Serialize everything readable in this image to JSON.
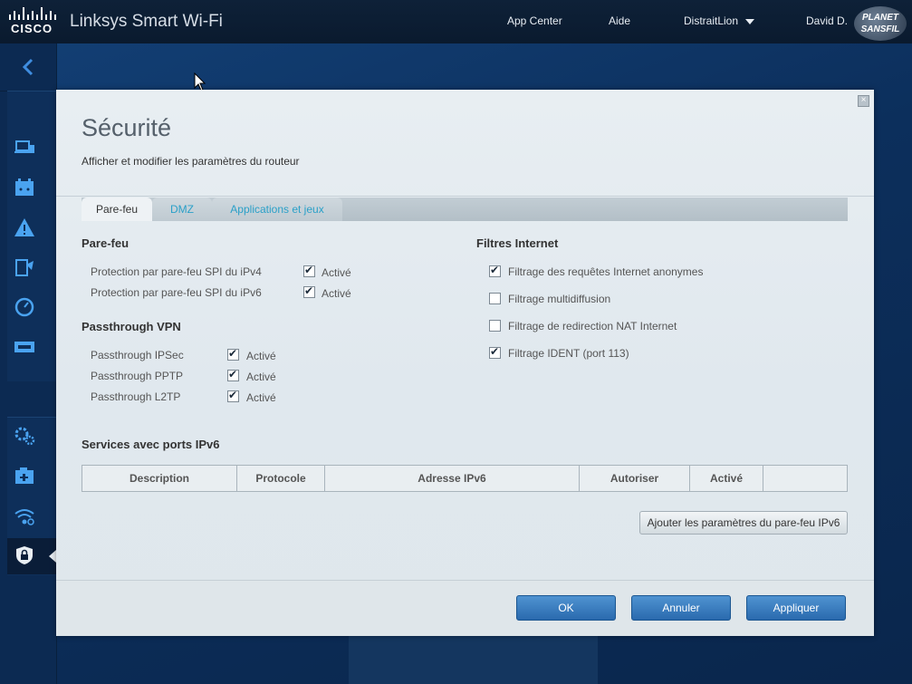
{
  "header": {
    "cisco": "CISCO",
    "brand": "Linksys Smart Wi-Fi",
    "nav": {
      "app_center": "App Center",
      "help": "Aide",
      "network": "DistraitLion",
      "user": "David D."
    },
    "watermark": "PLANET SANSFIL"
  },
  "sidebar": {
    "icons": [
      "back-arrow-icon",
      "devices-icon",
      "calendar-icon",
      "warning-icon",
      "update-icon",
      "speedometer-icon",
      "usb-icon",
      "settings-icon",
      "camera-icon",
      "wifi-icon",
      "lock-icon"
    ]
  },
  "modal": {
    "close": "×",
    "title": "Sécurité",
    "subtitle": "Afficher et modifier les paramètres du routeur",
    "tabs": [
      "Pare-feu",
      "DMZ",
      "Applications et jeux"
    ],
    "firewall": {
      "title": "Pare-feu",
      "rows": [
        {
          "label": "Protection par pare-feu SPI du iPv4",
          "status": "Activé",
          "checked": true
        },
        {
          "label": "Protection par pare-feu SPI du iPv6",
          "status": "Activé",
          "checked": true
        }
      ]
    },
    "vpn": {
      "title": "Passthrough VPN",
      "rows": [
        {
          "label": "Passthrough IPSec",
          "status": "Activé",
          "checked": true
        },
        {
          "label": "Passthrough PPTP",
          "status": "Activé",
          "checked": true
        },
        {
          "label": "Passthrough L2TP",
          "status": "Activé",
          "checked": true
        }
      ]
    },
    "filters": {
      "title": "Filtres Internet",
      "rows": [
        {
          "label": "Filtrage des requêtes Internet anonymes",
          "checked": true
        },
        {
          "label": "Filtrage multidiffusion",
          "checked": false
        },
        {
          "label": "Filtrage de redirection NAT Internet",
          "checked": false
        },
        {
          "label": "Filtrage IDENT (port 113)",
          "checked": true
        }
      ]
    },
    "ipv6_services": {
      "title": "Services avec ports IPv6",
      "columns": [
        "Description",
        "Protocole",
        "Adresse IPv6",
        "Autoriser",
        "Activé",
        ""
      ],
      "add_button": "Ajouter les paramètres du pare-feu IPv6"
    },
    "footer": {
      "ok": "OK",
      "cancel": "Annuler",
      "apply": "Appliquer"
    }
  },
  "colors": {
    "accent": "#2a6aae",
    "tab_link": "#2aa0c8",
    "header_bg": "#0e2138"
  }
}
